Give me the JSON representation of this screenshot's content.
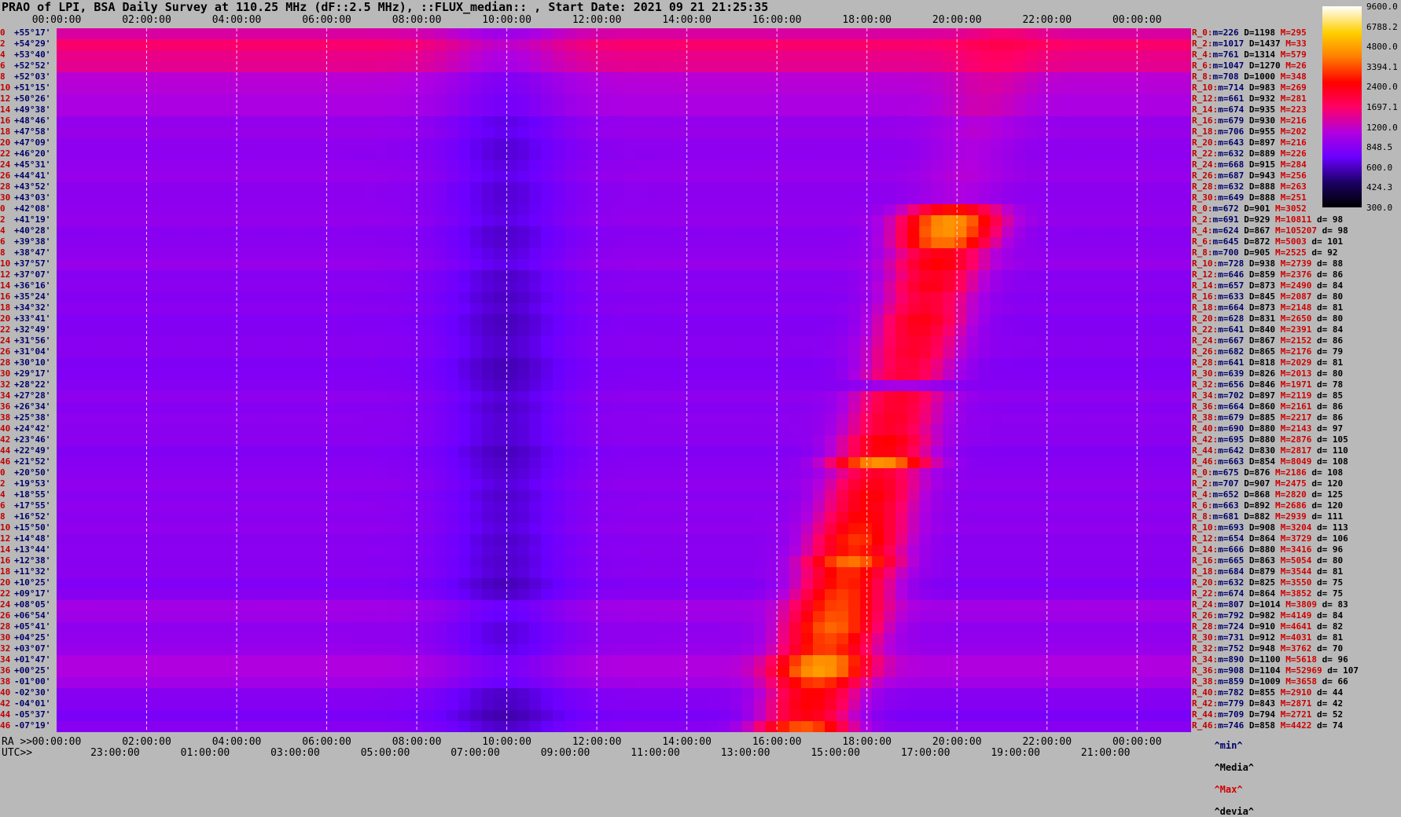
{
  "title": "PRAO of LPI, BSA Daily Survey at 110.25 MHz (dF::2.5 MHz), ::FLUX_median:: , Start Date: 2021 09 21 21:25:35",
  "chart_data": {
    "type": "heatmap",
    "title": "PRAO of LPI, BSA Daily Survey at 110.25 MHz (dF::2.5 MHz), ::FLUX_median:: , Start Date: 2021 09 21 21:25:35",
    "x_top_ticks": [
      "00:00:00",
      "02:00:00",
      "04:00:00",
      "06:00:00",
      "08:00:00",
      "10:00:00",
      "12:00:00",
      "14:00:00",
      "16:00:00",
      "18:00:00",
      "20:00:00",
      "22:00:00",
      "00:00:00"
    ],
    "ra_label": "RA >>",
    "ra_ticks": [
      "00:00:00",
      "02:00:00",
      "04:00:00",
      "06:00:00",
      "08:00:00",
      "10:00:00",
      "12:00:00",
      "14:00:00",
      "16:00:00",
      "18:00:00",
      "20:00:00",
      "22:00:00",
      "00:00:00"
    ],
    "utc_label": "UTC>>",
    "utc_ticks": [
      "23:00:00",
      "01:00:00",
      "03:00:00",
      "05:00:00",
      "07:00:00",
      "09:00:00",
      "11:00:00",
      "13:00:00",
      "15:00:00",
      "17:00:00",
      "19:00:00",
      "21:00:00"
    ],
    "rows": [
      {
        "n": "0",
        "dec": "+55°17'"
      },
      {
        "n": "2",
        "dec": "+54°29'"
      },
      {
        "n": "4",
        "dec": "+53°40'"
      },
      {
        "n": "6",
        "dec": "+52°52'"
      },
      {
        "n": "8",
        "dec": "+52°03'"
      },
      {
        "n": "10",
        "dec": "+51°15'"
      },
      {
        "n": "12",
        "dec": "+50°26'"
      },
      {
        "n": "14",
        "dec": "+49°38'"
      },
      {
        "n": "16",
        "dec": "+48°46'"
      },
      {
        "n": "18",
        "dec": "+47°58'"
      },
      {
        "n": "20",
        "dec": "+47°09'"
      },
      {
        "n": "22",
        "dec": "+46°20'"
      },
      {
        "n": "24",
        "dec": "+45°31'"
      },
      {
        "n": "26",
        "dec": "+44°41'"
      },
      {
        "n": "28",
        "dec": "+43°52'"
      },
      {
        "n": "30",
        "dec": "+43°03'"
      },
      {
        "n": "0",
        "dec": "+42°08'"
      },
      {
        "n": "2",
        "dec": "+41°19'"
      },
      {
        "n": "4",
        "dec": "+40°28'"
      },
      {
        "n": "6",
        "dec": "+39°38'"
      },
      {
        "n": "8",
        "dec": "+38°47'"
      },
      {
        "n": "10",
        "dec": "+37°57'"
      },
      {
        "n": "12",
        "dec": "+37°07'"
      },
      {
        "n": "14",
        "dec": "+36°16'"
      },
      {
        "n": "16",
        "dec": "+35°24'"
      },
      {
        "n": "18",
        "dec": "+34°32'"
      },
      {
        "n": "20",
        "dec": "+33°41'"
      },
      {
        "n": "22",
        "dec": "+32°49'"
      },
      {
        "n": "24",
        "dec": "+31°56'"
      },
      {
        "n": "26",
        "dec": "+31°04'"
      },
      {
        "n": "28",
        "dec": "+30°10'"
      },
      {
        "n": "30",
        "dec": "+29°17'"
      },
      {
        "n": "32",
        "dec": "+28°22'"
      },
      {
        "n": "34",
        "dec": "+27°28'"
      },
      {
        "n": "36",
        "dec": "+26°34'"
      },
      {
        "n": "38",
        "dec": "+25°38'"
      },
      {
        "n": "40",
        "dec": "+24°42'"
      },
      {
        "n": "42",
        "dec": "+23°46'"
      },
      {
        "n": "44",
        "dec": "+22°49'"
      },
      {
        "n": "46",
        "dec": "+21°52'"
      },
      {
        "n": "0",
        "dec": "+20°50'"
      },
      {
        "n": "2",
        "dec": "+19°53'"
      },
      {
        "n": "4",
        "dec": "+18°55'"
      },
      {
        "n": "6",
        "dec": "+17°55'"
      },
      {
        "n": "8",
        "dec": "+16°52'"
      },
      {
        "n": "10",
        "dec": "+15°50'"
      },
      {
        "n": "12",
        "dec": "+14°48'"
      },
      {
        "n": "14",
        "dec": "+13°44'"
      },
      {
        "n": "16",
        "dec": "+12°38'"
      },
      {
        "n": "18",
        "dec": "+11°32'"
      },
      {
        "n": "20",
        "dec": "+10°25'"
      },
      {
        "n": "22",
        "dec": "+09°17'"
      },
      {
        "n": "24",
        "dec": "+08°05'"
      },
      {
        "n": "26",
        "dec": "+06°54'"
      },
      {
        "n": "28",
        "dec": "+05°41'"
      },
      {
        "n": "30",
        "dec": "+04°25'"
      },
      {
        "n": "32",
        "dec": "+03°07'"
      },
      {
        "n": "34",
        "dec": "+01°47'"
      },
      {
        "n": "36",
        "dec": "+00°25'"
      },
      {
        "n": "38",
        "dec": "-01°00'"
      },
      {
        "n": "40",
        "dec": "-02°30'"
      },
      {
        "n": "42",
        "dec": "-04°01'"
      },
      {
        "n": "44",
        "dec": "-05°37'"
      },
      {
        "n": "46",
        "dec": "-07°19'"
      }
    ],
    "stats": [
      {
        "r": "R_0:",
        "min": 226,
        "med": 1198,
        "max": 295,
        "dev": ""
      },
      {
        "r": "R_2:",
        "min": 1017,
        "med": 1437,
        "max": 33,
        "dev": ""
      },
      {
        "r": "R_4:",
        "min": 761,
        "med": 1314,
        "max": 579,
        "dev": ""
      },
      {
        "r": "R_6:",
        "min": 1047,
        "med": 1270,
        "max": 26,
        "dev": ""
      },
      {
        "r": "R_8:",
        "min": 708,
        "med": 1000,
        "max": 348,
        "dev": ""
      },
      {
        "r": "R_10:",
        "min": 714,
        "med": 983,
        "max": 269,
        "dev": ""
      },
      {
        "r": "R_12:",
        "min": 661,
        "med": 932,
        "max": 281,
        "dev": ""
      },
      {
        "r": "R_14:",
        "min": 674,
        "med": 935,
        "max": 223,
        "dev": ""
      },
      {
        "r": "R_16:",
        "min": 679,
        "med": 930,
        "max": 216,
        "dev": ""
      },
      {
        "r": "R_18:",
        "min": 706,
        "med": 955,
        "max": 202,
        "dev": ""
      },
      {
        "r": "R_20:",
        "min": 643,
        "med": 897,
        "max": 216,
        "dev": ""
      },
      {
        "r": "R_22:",
        "min": 632,
        "med": 889,
        "max": 226,
        "dev": ""
      },
      {
        "r": "R_24:",
        "min": 668,
        "med": 915,
        "max": 284,
        "dev": ""
      },
      {
        "r": "R_26:",
        "min": 687,
        "med": 943,
        "max": 256,
        "dev": ""
      },
      {
        "r": "R_28:",
        "min": 632,
        "med": 888,
        "max": 263,
        "dev": ""
      },
      {
        "r": "R_30:",
        "min": 649,
        "med": 888,
        "max": 251,
        "dev": ""
      },
      {
        "r": "R_0:",
        "min": 672,
        "med": 901,
        "max": 3052,
        "dev": ""
      },
      {
        "r": "R_2:",
        "min": 691,
        "med": 929,
        "max": 10811,
        "dev": "98"
      },
      {
        "r": "R_4:",
        "min": 624,
        "med": 867,
        "max": 105207,
        "dev": "98"
      },
      {
        "r": "R_6:",
        "min": 645,
        "med": 872,
        "max": 5003,
        "dev": "101"
      },
      {
        "r": "R_8:",
        "min": 700,
        "med": 905,
        "max": 2525,
        "dev": "92"
      },
      {
        "r": "R_10:",
        "min": 728,
        "med": 938,
        "max": 2739,
        "dev": "88"
      },
      {
        "r": "R_12:",
        "min": 646,
        "med": 859,
        "max": 2376,
        "dev": "86"
      },
      {
        "r": "R_14:",
        "min": 657,
        "med": 873,
        "max": 2490,
        "dev": "84"
      },
      {
        "r": "R_16:",
        "min": 633,
        "med": 845,
        "max": 2087,
        "dev": "80"
      },
      {
        "r": "R_18:",
        "min": 664,
        "med": 873,
        "max": 2148,
        "dev": "81"
      },
      {
        "r": "R_20:",
        "min": 628,
        "med": 831,
        "max": 2650,
        "dev": "80"
      },
      {
        "r": "R_22:",
        "min": 641,
        "med": 840,
        "max": 2391,
        "dev": "84"
      },
      {
        "r": "R_24:",
        "min": 667,
        "med": 867,
        "max": 2152,
        "dev": "86"
      },
      {
        "r": "R_26:",
        "min": 682,
        "med": 865,
        "max": 2176,
        "dev": "79"
      },
      {
        "r": "R_28:",
        "min": 641,
        "med": 818,
        "max": 2029,
        "dev": "81"
      },
      {
        "r": "R_30:",
        "min": 639,
        "med": 826,
        "max": 2013,
        "dev": "80"
      },
      {
        "r": "R_32:",
        "min": 656,
        "med": 846,
        "max": 1971,
        "dev": "78"
      },
      {
        "r": "R_34:",
        "min": 702,
        "med": 897,
        "max": 2119,
        "dev": "85"
      },
      {
        "r": "R_36:",
        "min": 664,
        "med": 860,
        "max": 2161,
        "dev": "86"
      },
      {
        "r": "R_38:",
        "min": 679,
        "med": 885,
        "max": 2217,
        "dev": "86"
      },
      {
        "r": "R_40:",
        "min": 690,
        "med": 880,
        "max": 2143,
        "dev": "97"
      },
      {
        "r": "R_42:",
        "min": 695,
        "med": 880,
        "max": 2876,
        "dev": "105"
      },
      {
        "r": "R_44:",
        "min": 642,
        "med": 830,
        "max": 2817,
        "dev": "110"
      },
      {
        "r": "R_46:",
        "min": 663,
        "med": 854,
        "max": 8049,
        "dev": "108"
      },
      {
        "r": "R_0:",
        "min": 675,
        "med": 876,
        "max": 2186,
        "dev": "108"
      },
      {
        "r": "R_2:",
        "min": 707,
        "med": 907,
        "max": 2475,
        "dev": "120"
      },
      {
        "r": "R_4:",
        "min": 652,
        "med": 868,
        "max": 2820,
        "dev": "125"
      },
      {
        "r": "R_6:",
        "min": 663,
        "med": 892,
        "max": 2686,
        "dev": "120"
      },
      {
        "r": "R_8:",
        "min": 681,
        "med": 882,
        "max": 2939,
        "dev": "111"
      },
      {
        "r": "R_10:",
        "min": 693,
        "med": 908,
        "max": 3204,
        "dev": "113"
      },
      {
        "r": "R_12:",
        "min": 654,
        "med": 864,
        "max": 3729,
        "dev": "106"
      },
      {
        "r": "R_14:",
        "min": 666,
        "med": 880,
        "max": 3416,
        "dev": "96"
      },
      {
        "r": "R_16:",
        "min": 665,
        "med": 863,
        "max": 5054,
        "dev": "80"
      },
      {
        "r": "R_18:",
        "min": 684,
        "med": 879,
        "max": 3544,
        "dev": "81"
      },
      {
        "r": "R_20:",
        "min": 632,
        "med": 825,
        "max": 3550,
        "dev": "75"
      },
      {
        "r": "R_22:",
        "min": 674,
        "med": 864,
        "max": 3852,
        "dev": "75"
      },
      {
        "r": "R_24:",
        "min": 807,
        "med": 1014,
        "max": 3809,
        "dev": "83"
      },
      {
        "r": "R_26:",
        "min": 792,
        "med": 982,
        "max": 4149,
        "dev": "84"
      },
      {
        "r": "R_28:",
        "min": 724,
        "med": 910,
        "max": 4641,
        "dev": "82"
      },
      {
        "r": "R_30:",
        "min": 731,
        "med": 912,
        "max": 4031,
        "dev": "81"
      },
      {
        "r": "R_32:",
        "min": 752,
        "med": 948,
        "max": 3762,
        "dev": "70"
      },
      {
        "r": "R_34:",
        "min": 890,
        "med": 1100,
        "max": 5618,
        "dev": "96"
      },
      {
        "r": "R_36:",
        "min": 908,
        "med": 1104,
        "max": 52969,
        "dev": "107"
      },
      {
        "r": "R_38:",
        "min": 859,
        "med": 1009,
        "max": 3658,
        "dev": "66"
      },
      {
        "r": "R_40:",
        "min": 782,
        "med": 855,
        "max": 2910,
        "dev": "44"
      },
      {
        "r": "R_42:",
        "min": 779,
        "med": 843,
        "max": 2871,
        "dev": "42"
      },
      {
        "r": "R_44:",
        "min": 709,
        "med": 794,
        "max": 2721,
        "dev": "52"
      },
      {
        "r": "R_46:",
        "min": 746,
        "med": 858,
        "max": 4422,
        "dev": "74"
      }
    ],
    "stat_legend": {
      "min": "^min^",
      "med": "^Media^",
      "max": "^Max^",
      "dev": "^devia^"
    },
    "colorbar": {
      "ticks": [
        "9600.0",
        "6788.2",
        "4800.0",
        "3394.1",
        "2400.0",
        "1697.1",
        "1200.0",
        "848.5",
        "600.0",
        "424.3",
        "300.0"
      ],
      "scale": "log",
      "range": [
        300,
        9600
      ],
      "colors": [
        "#000000",
        "#1a0060",
        "#6a00ff",
        "#b000e0",
        "#ff0066",
        "#ff0000",
        "#ff7f00",
        "#ffd000",
        "#ffffff"
      ]
    },
    "colors": {
      "background": "#b9b9b9",
      "grid": "#ffffff",
      "label_red": "#c00000",
      "label_navy": "#00006a"
    }
  }
}
